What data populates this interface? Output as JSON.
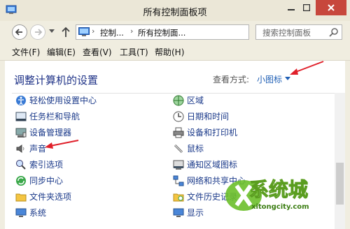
{
  "window": {
    "title": "所有控制面板项",
    "controls": {
      "minimize": "minimize-icon",
      "maximize": "maximize-icon",
      "close": "close-icon"
    }
  },
  "navigation": {
    "back": "back-arrow-icon",
    "forward": "forward-arrow-icon",
    "up": "up-arrow-icon",
    "breadcrumb": [
      "控制...",
      "所有控制面..."
    ],
    "refresh": "refresh-icon",
    "search_placeholder": "搜索控制面板"
  },
  "menu": {
    "items": [
      "文件(F)",
      "编辑(E)",
      "查看(V)",
      "工具(T)",
      "帮助(H)"
    ]
  },
  "content": {
    "heading": "调整计算机的设置",
    "view_by_label": "查看方式:",
    "view_by_value": "小图标",
    "left_items": [
      {
        "label": "轻松使用设置中心",
        "icon": "ease-of-access-icon"
      },
      {
        "label": "任务栏和导航",
        "icon": "taskbar-icon"
      },
      {
        "label": "设备管理器",
        "icon": "device-manager-icon"
      },
      {
        "label": "声音",
        "icon": "speaker-icon"
      },
      {
        "label": "索引选项",
        "icon": "indexing-icon"
      },
      {
        "label": "同步中心",
        "icon": "sync-icon"
      },
      {
        "label": "文件夹选项",
        "icon": "folder-icon"
      },
      {
        "label": "系统",
        "icon": "system-icon"
      }
    ],
    "right_items": [
      {
        "label": "区域",
        "icon": "region-icon"
      },
      {
        "label": "日期和时间",
        "icon": "clock-icon"
      },
      {
        "label": "设备和打印机",
        "icon": "printer-icon"
      },
      {
        "label": "鼠标",
        "icon": "mouse-icon"
      },
      {
        "label": "通知区域图标",
        "icon": "notification-icon"
      },
      {
        "label": "网络和共享中心",
        "icon": "network-icon"
      },
      {
        "label": "文件历史记录",
        "icon": "file-history-icon"
      },
      {
        "label": "显示",
        "icon": "display-icon"
      }
    ]
  },
  "annotations": {
    "arrow_color": "#e0202a"
  },
  "watermark": {
    "brand": "系统城",
    "url": "xitongcity.com"
  }
}
